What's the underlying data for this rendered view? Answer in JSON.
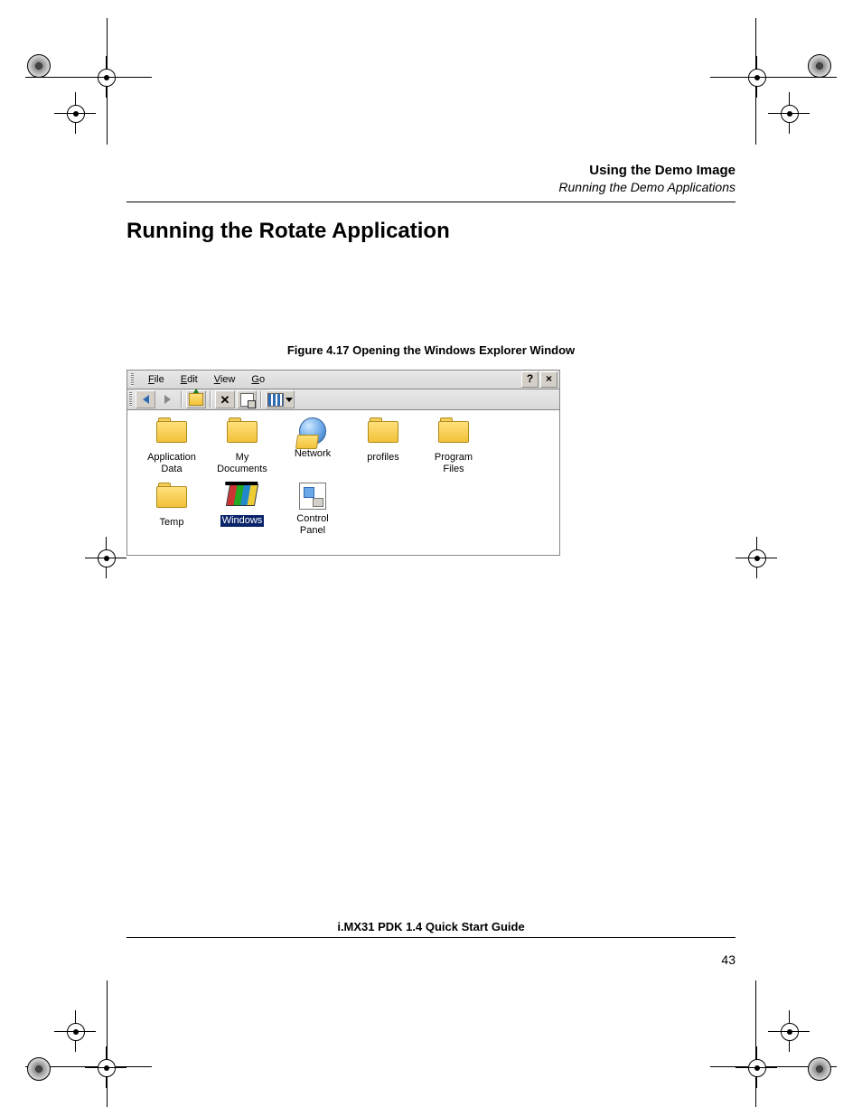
{
  "header": {
    "chapter": "Using the Demo Image",
    "subchapter": "Running the Demo Applications"
  },
  "section_title": "Running the Rotate Application",
  "figure_caption": "Figure 4.17  Opening the Windows Explorer Window",
  "explorer": {
    "menus": {
      "file": "File",
      "edit": "Edit",
      "view": "View",
      "go": "Go"
    },
    "title_buttons": {
      "help": "?",
      "close": "×"
    },
    "items": [
      {
        "label": "Application Data",
        "type": "folder",
        "selected": false
      },
      {
        "label": "My Documents",
        "type": "folder",
        "selected": false
      },
      {
        "label": "Network",
        "type": "network",
        "selected": false
      },
      {
        "label": "profiles",
        "type": "folder",
        "selected": false
      },
      {
        "label": "Program Files",
        "type": "folder",
        "selected": false
      },
      {
        "label": "Temp",
        "type": "folder",
        "selected": false
      },
      {
        "label": "Windows",
        "type": "windows",
        "selected": true
      },
      {
        "label": "Control Panel",
        "type": "cpl",
        "selected": false
      }
    ]
  },
  "footer": {
    "title": "i.MX31 PDK 1.4 Quick Start Guide",
    "page": "43"
  }
}
